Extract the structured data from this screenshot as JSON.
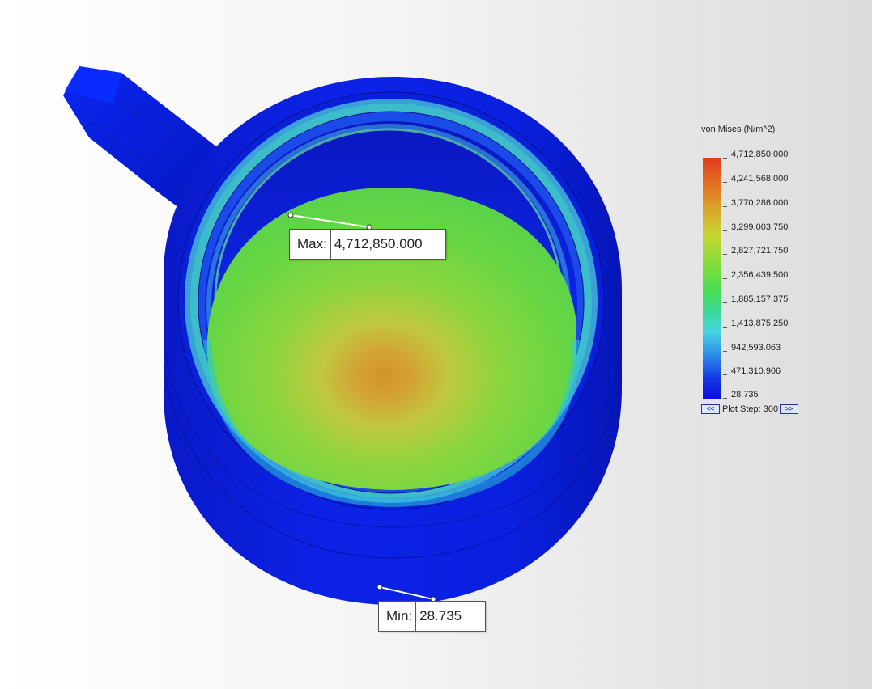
{
  "results": {
    "max_label": "Max:",
    "max_value": "4,712,850.000",
    "min_label": "Min:",
    "min_value": "28.735"
  },
  "legend": {
    "title": "von Mises (N/m^2)",
    "labels": [
      "4,712,850.000",
      "4,241,568.000",
      "3,770,286.000",
      "3,299,003.750",
      "2,827,721.750",
      "2,356,439.500",
      "1,885,157.375",
      "1,413,875.250",
      "942,593.063",
      "471,310.906",
      "28.735"
    ],
    "colors": {
      "max": "#e23a1f",
      "mid": "#45dd55",
      "min": "#0d10d8"
    },
    "plot_step_text": "Plot Step: 300",
    "prev_icon": "double-left-arrow-icon",
    "next_icon": "double-right-arrow-icon",
    "prev_glyph": "<<",
    "next_glyph": ">>"
  },
  "model": {
    "body_color": "#0a1ee0",
    "inner_color": "#6fd84a",
    "hotspot_color": "#d6962c",
    "rim_color": "#5fd1c8"
  }
}
